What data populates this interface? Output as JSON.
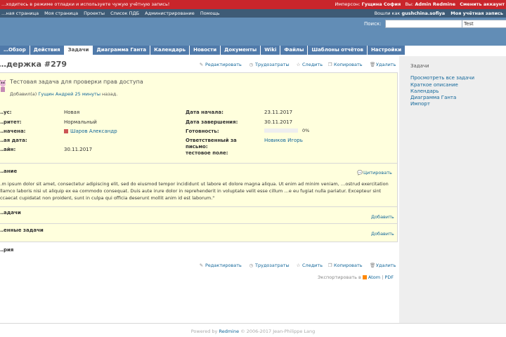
{
  "warnbar": {
    "left_text": "…ходитесь в режиме отладки и используете чужую учётную запись!",
    "impersonate_label": "Имперсон:",
    "impersonate_user": "Гущина София",
    "you_label": "Вы:",
    "you_user": "Admin Redmine",
    "switch_link": "Сменить аккаунт"
  },
  "topmenu": {
    "items": [
      "…ная страница",
      "Моя страница",
      "Проекты",
      "Список ПДБ",
      "Администрирование",
      "Помощь"
    ],
    "logged_prefix": "Вошли как",
    "logged_user": "gushchina.sofiya",
    "my_account": "Моя учётная запись"
  },
  "header": {
    "search_label": "Поиск:",
    "search_value": "",
    "project_select": "Test"
  },
  "tabs": [
    {
      "label": "…Обзор",
      "selected": false
    },
    {
      "label": "Действия",
      "selected": false
    },
    {
      "label": "Задачи",
      "selected": true
    },
    {
      "label": "Диаграмма Ганта",
      "selected": false
    },
    {
      "label": "Календарь",
      "selected": false
    },
    {
      "label": "Новости",
      "selected": false
    },
    {
      "label": "Документы",
      "selected": false
    },
    {
      "label": "Wiki",
      "selected": false
    },
    {
      "label": "Файлы",
      "selected": false
    },
    {
      "label": "Шаблоны отчётов",
      "selected": false
    },
    {
      "label": "Настройки",
      "selected": false
    }
  ],
  "issue": {
    "title": "…держка #279",
    "subject": "Тестовая задача для проверки прав доступа",
    "added_by_prefix": "Добавил(а)",
    "author": "Гущин Андрей",
    "time_ago": "25 минуты",
    "time_suffix": "назад.",
    "attributes": {
      "status_label": "…ус:",
      "status_value": "Новая",
      "priority_label": "…ритет:",
      "priority_value": "Нормальный",
      "assignee_label": "…начена:",
      "assignee_value": "Шаров Александр",
      "category_label": "…ая дата:",
      "category_value": "",
      "due_label": "…айн:",
      "due_value": "30.11.2017",
      "start_label": "Дата начала:",
      "start_value": "23.11.2017",
      "end_label": "Дата завершения:",
      "end_value": "30.11.2017",
      "done_label": "Готовность:",
      "done_value": "0%",
      "done_fraction": 0.0,
      "resp_label_1": "Ответственный за",
      "resp_label_2": "письмо:",
      "resp_value": "Новиков Игорь",
      "test_label": "тестовое поле:"
    },
    "description_title": "…ание",
    "quote_label": "Цитировать",
    "description": "…m ipsum dolor sit amet, consectetur adipiscing elit, sed do eiusmod tempor incididunt ut labore et dolore magna aliqua. Ut enim ad minim veniam, …ostrud exercitation ullamco laboris nisi ut aliquip ex ea commodo consequat. Duis aute irure dolor in reprehenderit in voluptate velit esse cillum …e eu fugiat nulla pariatur. Excepteur sint occaecat cupidatat non proident, sunt in culpa qui officia deserunt mollit anim id est laborum.\"",
    "subtasks_title": "…адачи",
    "related_title": "…енные задачи",
    "add_label": "Добавить",
    "history_title": "…рия"
  },
  "contextual": {
    "edit": "Редактировать",
    "log_time": "Трудозатраты",
    "watch": "Следить",
    "copy": "Копировать",
    "delete": "Удалить"
  },
  "export": {
    "prefix": "Экспортировать в",
    "atom": "Atom",
    "sep": "|",
    "pdf": "PDF"
  },
  "sidebar": {
    "title": "Задачи",
    "links": [
      "Просмотреть все задачи",
      "Краткое описание",
      "Календарь",
      "Диаграмма Ганта",
      "Импорт"
    ]
  },
  "footer": {
    "prefix": "Powered by",
    "brand": "Redmine",
    "suffix": "© 2006-2017 Jean-Philippe Lang"
  }
}
